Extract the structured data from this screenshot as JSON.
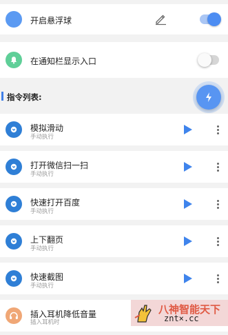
{
  "settings": {
    "float_ball": {
      "label": "开启悬浮球",
      "enabled": true,
      "icon": "blue-dot-icon",
      "edit_icon": "pencil-icon"
    },
    "notification": {
      "label": "在通知栏显示入口",
      "enabled": false,
      "icon": "bell-icon"
    }
  },
  "commands": {
    "section_title": "指令列表:",
    "fab_icon": "lightning-icon",
    "items": [
      {
        "title": "模拟滑动",
        "subtitle": "手动执行",
        "icon": "chevron-circle-icon"
      },
      {
        "title": "打开微信扫一扫",
        "subtitle": "手动执行",
        "icon": "chevron-circle-icon"
      },
      {
        "title": "快速打开百度",
        "subtitle": "手动执行",
        "icon": "chevron-circle-icon"
      },
      {
        "title": "上下翻页",
        "subtitle": "手动执行",
        "icon": "chevron-circle-icon"
      },
      {
        "title": "快速截图",
        "subtitle": "手动执行",
        "icon": "chevron-circle-icon"
      },
      {
        "title": "插入耳机降低音量",
        "subtitle": "插入耳机时",
        "icon": "headphones-icon"
      }
    ]
  },
  "watermark": {
    "line1": "八神智能天下",
    "line2": "znt×.cc"
  },
  "colors": {
    "accent": "#4d8df2",
    "item_icon": "#2f7fd6",
    "headphone_icon": "#f0a776",
    "bell_icon": "#5fcf98"
  }
}
